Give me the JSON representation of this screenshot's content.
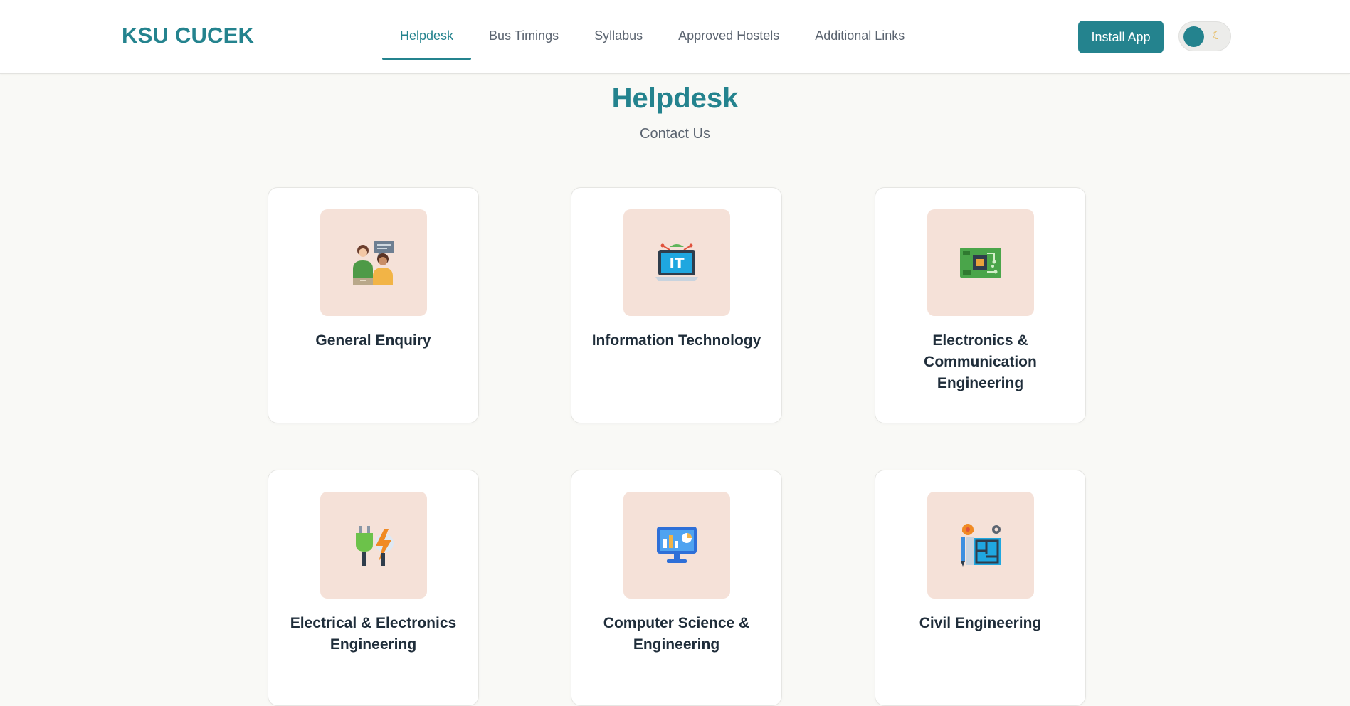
{
  "header": {
    "brand": "KSU CUCEK",
    "nav": [
      "Helpdesk",
      "Bus Timings",
      "Syllabus",
      "Approved Hostels",
      "Additional Links"
    ],
    "active_nav": "Helpdesk",
    "install_label": "Install App",
    "theme_toggle_icon": "moon-icon"
  },
  "main": {
    "title": "Helpdesk",
    "subtitle": "Contact Us",
    "cards": [
      {
        "label": "General Enquiry",
        "icon": "support-agents-icon"
      },
      {
        "label": "Information Technology",
        "icon": "it-laptop-icon"
      },
      {
        "label": "Electronics & Communication Engineering",
        "icon": "circuit-board-icon"
      },
      {
        "label": "Electrical & Electronics Engineering",
        "icon": "plug-bolt-icon"
      },
      {
        "label": "Computer Science & Engineering",
        "icon": "monitor-dashboard-icon"
      },
      {
        "label": "Civil Engineering",
        "icon": "blueprint-icon"
      }
    ]
  },
  "colors": {
    "accent": "#24838e",
    "background": "#f9f9f6",
    "icon_tile": "#f5e1d8"
  }
}
